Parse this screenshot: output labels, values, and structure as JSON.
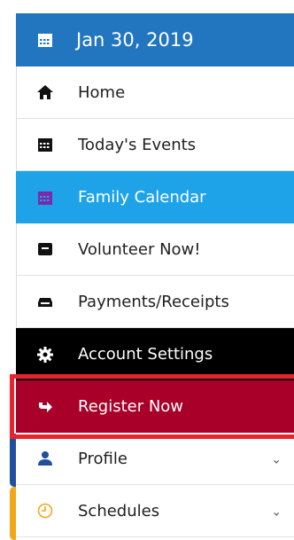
{
  "header": {
    "date": "Jan 30, 2019"
  },
  "menu": {
    "home": "Home",
    "todays_events": "Today's Events",
    "family_calendar": "Family Calendar",
    "volunteer": "Volunteer Now!",
    "payments": "Payments/Receipts",
    "account_settings": "Account Settings",
    "register": "Register Now",
    "profile": "Profile",
    "schedules": "Schedules"
  },
  "icons": {
    "header": "calendar-icon",
    "home": "home-icon",
    "todays_events": "calendar-icon",
    "family_calendar": "calendar-icon",
    "volunteer": "inbox-icon",
    "payments": "wallet-icon",
    "account_settings": "gear-icon",
    "register": "share-arrow-icon",
    "profile": "user-icon",
    "schedules": "clock-icon",
    "expand": "chevron-down-icon"
  },
  "colors": {
    "date_header": "#2276c0",
    "active_item": "#1ea3e8",
    "account_settings": "#000000",
    "register": "#a80029",
    "highlight_border": "#e8232d",
    "profile_accent": "#1f4f9e",
    "schedules_accent": "#f2a71b"
  }
}
